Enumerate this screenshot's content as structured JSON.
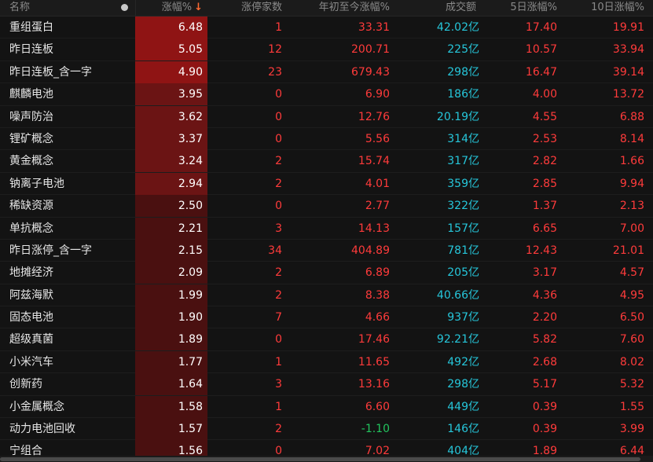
{
  "header": {
    "name": "名称",
    "pct": "涨幅%",
    "sort_arrow": "↓",
    "limit_up": "涨停家数",
    "ytd": "年初至今涨幅%",
    "volume": "成交额",
    "d5": "5日涨幅%",
    "d10": "10日涨幅%"
  },
  "colors": {
    "up": "#ff3b3b",
    "down": "#22c55e",
    "volume": "#26c6da",
    "pct_bar_strong": "#8f1414",
    "pct_bar_mid": "#6b1414",
    "pct_bar_weak": "#4a1010"
  },
  "rows": [
    {
      "name": "重组蛋白",
      "pct": "6.48",
      "limit": "1",
      "ytd": "33.31",
      "vol": "42.02亿",
      "d5": "17.40",
      "d10": "19.91"
    },
    {
      "name": "昨日连板",
      "pct": "5.05",
      "limit": "12",
      "ytd": "200.71",
      "vol": "225亿",
      "d5": "10.57",
      "d10": "33.94"
    },
    {
      "name": "昨日连板_含一字",
      "pct": "4.90",
      "limit": "23",
      "ytd": "679.43",
      "vol": "298亿",
      "d5": "16.47",
      "d10": "39.14"
    },
    {
      "name": "麒麟电池",
      "pct": "3.95",
      "limit": "0",
      "ytd": "6.90",
      "vol": "186亿",
      "d5": "4.00",
      "d10": "13.72"
    },
    {
      "name": "噪声防治",
      "pct": "3.62",
      "limit": "0",
      "ytd": "12.76",
      "vol": "20.19亿",
      "d5": "4.55",
      "d10": "6.88"
    },
    {
      "name": "锂矿概念",
      "pct": "3.37",
      "limit": "0",
      "ytd": "5.56",
      "vol": "314亿",
      "d5": "2.53",
      "d10": "8.14"
    },
    {
      "name": "黄金概念",
      "pct": "3.24",
      "limit": "2",
      "ytd": "15.74",
      "vol": "317亿",
      "d5": "2.82",
      "d10": "1.66"
    },
    {
      "name": "钠离子电池",
      "pct": "2.94",
      "limit": "2",
      "ytd": "4.01",
      "vol": "359亿",
      "d5": "2.85",
      "d10": "9.94"
    },
    {
      "name": "稀缺资源",
      "pct": "2.50",
      "limit": "0",
      "ytd": "2.77",
      "vol": "322亿",
      "d5": "1.37",
      "d10": "2.13"
    },
    {
      "name": "单抗概念",
      "pct": "2.21",
      "limit": "3",
      "ytd": "14.13",
      "vol": "157亿",
      "d5": "6.65",
      "d10": "7.00"
    },
    {
      "name": "昨日涨停_含一字",
      "pct": "2.15",
      "limit": "34",
      "ytd": "404.89",
      "vol": "781亿",
      "d5": "12.43",
      "d10": "21.01"
    },
    {
      "name": "地摊经济",
      "pct": "2.09",
      "limit": "2",
      "ytd": "6.89",
      "vol": "205亿",
      "d5": "3.17",
      "d10": "4.57"
    },
    {
      "name": "阿兹海默",
      "pct": "1.99",
      "limit": "2",
      "ytd": "8.38",
      "vol": "40.66亿",
      "d5": "4.36",
      "d10": "4.95"
    },
    {
      "name": "固态电池",
      "pct": "1.90",
      "limit": "7",
      "ytd": "4.66",
      "vol": "937亿",
      "d5": "2.20",
      "d10": "6.50"
    },
    {
      "name": "超级真菌",
      "pct": "1.89",
      "limit": "0",
      "ytd": "17.46",
      "vol": "92.21亿",
      "d5": "5.82",
      "d10": "7.60"
    },
    {
      "name": "小米汽车",
      "pct": "1.77",
      "limit": "1",
      "ytd": "11.65",
      "vol": "492亿",
      "d5": "2.68",
      "d10": "8.02"
    },
    {
      "name": "创新药",
      "pct": "1.64",
      "limit": "3",
      "ytd": "13.16",
      "vol": "298亿",
      "d5": "5.17",
      "d10": "5.32"
    },
    {
      "name": "小金属概念",
      "pct": "1.58",
      "limit": "1",
      "ytd": "6.60",
      "vol": "449亿",
      "d5": "0.39",
      "d10": "1.55"
    },
    {
      "name": "动力电池回收",
      "pct": "1.57",
      "limit": "2",
      "ytd": "-1.10",
      "vol": "146亿",
      "d5": "0.39",
      "d10": "3.99"
    },
    {
      "name": "宁组合",
      "pct": "1.56",
      "limit": "0",
      "ytd": "7.02",
      "vol": "404亿",
      "d5": "1.89",
      "d10": "6.44"
    }
  ]
}
